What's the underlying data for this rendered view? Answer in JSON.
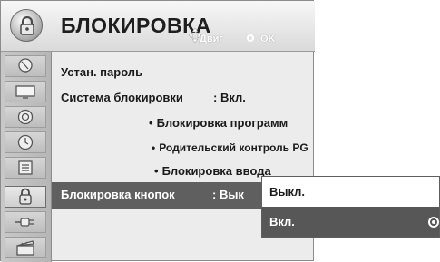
{
  "header": {
    "title": "БЛОКИРОВКА",
    "nav_hint": "Двиг",
    "ok_hint": "OK",
    "icon": "lock-icon"
  },
  "rail": {
    "items": [
      {
        "icon": "satellite-dish-icon"
      },
      {
        "icon": "tv-screen-icon"
      },
      {
        "icon": "speaker-icon"
      },
      {
        "icon": "clock-icon"
      },
      {
        "icon": "option-icon"
      },
      {
        "icon": "lock-icon",
        "active": true
      },
      {
        "icon": "input-plug-icon"
      },
      {
        "icon": "media-clapper-icon"
      }
    ]
  },
  "menu": {
    "set_password": "Устан. пароль",
    "lock_system": "Система блокировки",
    "lock_system_value": ": Вкл.",
    "block_programs": "Блокировка программ",
    "parental_control": "Родительский контроль PG",
    "input_lock": "Блокировка ввода",
    "key_lock": "Блокировка кнопок",
    "key_lock_value": ": Вык",
    "bullet": "•"
  },
  "popup": {
    "options": [
      {
        "label": "Выкл.",
        "selected": false
      },
      {
        "label": "Вкл.",
        "selected": true
      }
    ]
  },
  "colors": {
    "selection": "#5f5f5f",
    "panel": "#ececec",
    "rail": "#bebebe"
  }
}
